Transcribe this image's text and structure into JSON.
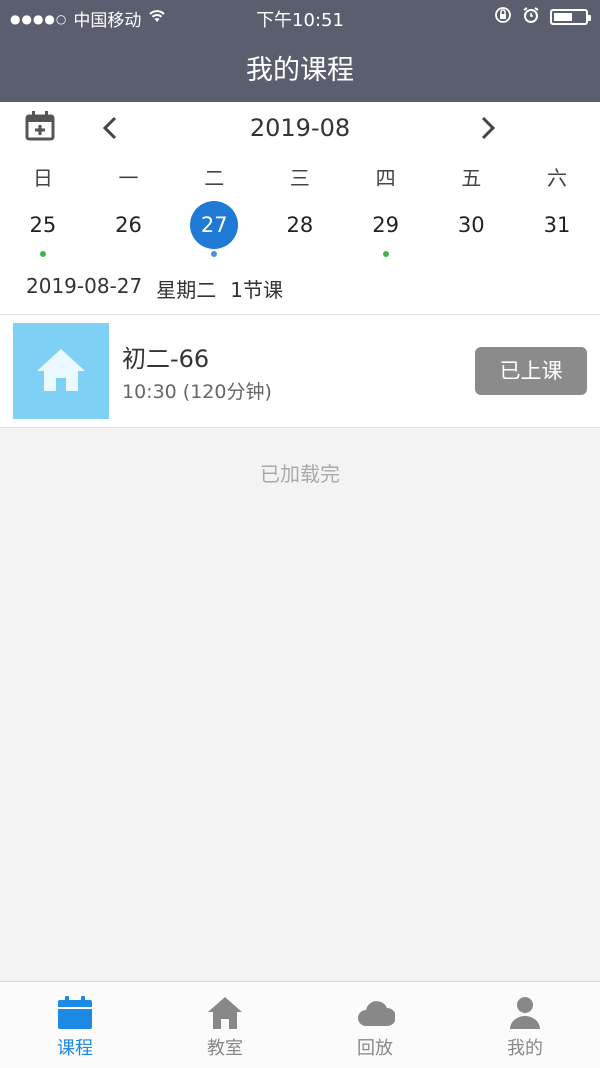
{
  "status_bar": {
    "signal": "●●●●○",
    "carrier": "中国移动",
    "time": "下午10:51"
  },
  "header": {
    "title": "我的课程"
  },
  "calendar": {
    "month": "2019-08",
    "weekdays": [
      "日",
      "一",
      "二",
      "三",
      "四",
      "五",
      "六"
    ],
    "days": [
      {
        "label": "25",
        "has_course": true,
        "selected": false
      },
      {
        "label": "26",
        "has_course": false,
        "selected": false
      },
      {
        "label": "27",
        "has_course": true,
        "selected": true
      },
      {
        "label": "28",
        "has_course": false,
        "selected": false
      },
      {
        "label": "29",
        "has_course": true,
        "selected": false
      },
      {
        "label": "30",
        "has_course": false,
        "selected": false
      },
      {
        "label": "31",
        "has_course": false,
        "selected": false
      }
    ],
    "summary": {
      "date": "2019-08-27",
      "weekday": "星期二",
      "count": "1节课"
    }
  },
  "courses": [
    {
      "name": "初二-66",
      "time": "10:30 (120分钟)",
      "status": "已上课"
    }
  ],
  "list_footer": "已加载完",
  "tabbar": {
    "items": [
      {
        "label": "课程",
        "icon": "calendar-icon",
        "active": true
      },
      {
        "label": "教室",
        "icon": "house-icon",
        "active": false
      },
      {
        "label": "回放",
        "icon": "cloud-icon",
        "active": false
      },
      {
        "label": "我的",
        "icon": "person-icon",
        "active": false
      }
    ]
  },
  "colors": {
    "header_bg": "#5b5e6e",
    "accent": "#1f7ad6",
    "dot_green": "#46b04b",
    "status_button": "#8b8b8b",
    "thumb_bg": "#7fd0f5"
  }
}
